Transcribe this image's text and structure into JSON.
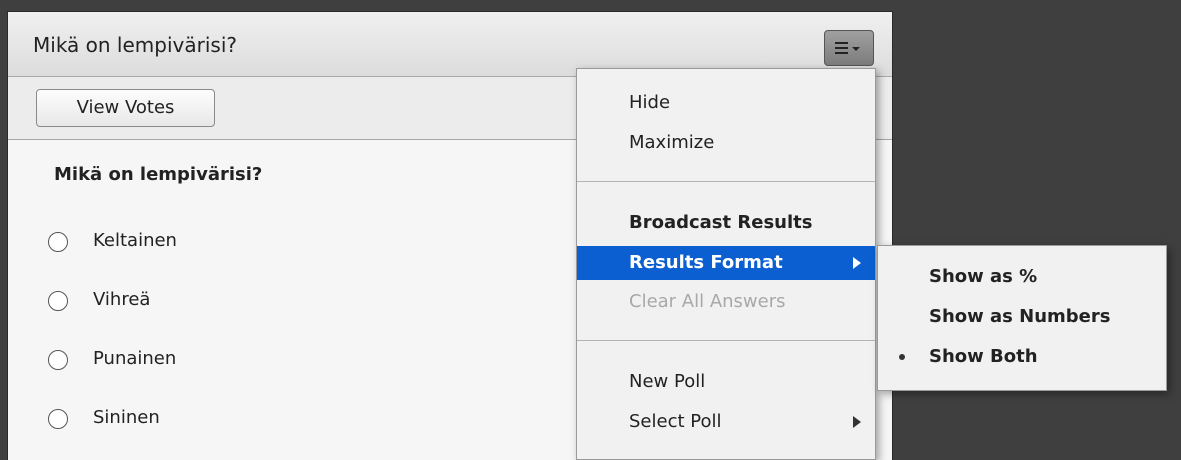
{
  "pod": {
    "title": "Mikä on lempivärisi?",
    "menu_icon": "hamburger-menu-icon",
    "view_votes_label": "View Votes",
    "question": "Mikä on lempivärisi?",
    "options": [
      {
        "label": "Keltainen"
      },
      {
        "label": "Vihreä"
      },
      {
        "label": "Punainen"
      },
      {
        "label": "Sininen"
      }
    ]
  },
  "menu": {
    "hide": "Hide",
    "maximize": "Maximize",
    "broadcast_results": "Broadcast Results",
    "results_format": "Results Format",
    "clear_all_answers": "Clear All Answers",
    "new_poll": "New Poll",
    "select_poll": "Select Poll"
  },
  "submenu": {
    "show_percent": "Show as %",
    "show_numbers": "Show as Numbers",
    "show_both": "Show Both",
    "selected": "Show Both"
  },
  "colors": {
    "highlight": "#0b5fd0",
    "background": "#3f3f3f"
  }
}
